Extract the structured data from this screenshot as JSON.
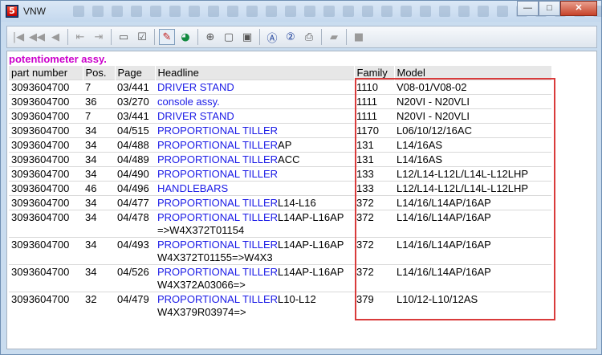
{
  "window": {
    "title": "VNW",
    "app_icon_letter": "5"
  },
  "toolbar": {
    "buttons": [
      {
        "name": "first-icon",
        "glyph": "|◀",
        "state": "disabled"
      },
      {
        "name": "rewind-icon",
        "glyph": "◀◀",
        "state": "disabled"
      },
      {
        "name": "prev-icon",
        "glyph": "◀",
        "state": "disabled"
      },
      {
        "name": "sep"
      },
      {
        "name": "page-back-icon",
        "glyph": "⇤",
        "state": "disabled"
      },
      {
        "name": "page-forward-icon",
        "glyph": "⇥",
        "state": "disabled"
      },
      {
        "name": "sep"
      },
      {
        "name": "cart-icon",
        "glyph": "▭",
        "state": "normal"
      },
      {
        "name": "checklist-icon",
        "glyph": "☑",
        "state": "normal"
      },
      {
        "name": "sep"
      },
      {
        "name": "pen-tool-icon",
        "glyph": "✎",
        "state": "active",
        "color": "red"
      },
      {
        "name": "globe-icon",
        "glyph": "◕",
        "state": "normal",
        "color": "green"
      },
      {
        "name": "sep"
      },
      {
        "name": "zoom-icon",
        "glyph": "⊕",
        "state": "normal"
      },
      {
        "name": "page-icon",
        "glyph": "▢",
        "state": "normal"
      },
      {
        "name": "page-copy-icon",
        "glyph": "▣",
        "state": "normal"
      },
      {
        "name": "sep"
      },
      {
        "name": "search-a-icon",
        "glyph": "Ⓐ",
        "state": "normal",
        "color": "blue"
      },
      {
        "name": "help-icon",
        "glyph": "②",
        "state": "normal",
        "color": "blue"
      },
      {
        "name": "print-icon",
        "glyph": "⎙",
        "state": "normal"
      },
      {
        "name": "sep"
      },
      {
        "name": "eraser-icon",
        "glyph": "▰",
        "state": "disabled"
      },
      {
        "name": "sep"
      },
      {
        "name": "stop-icon",
        "glyph": "■",
        "state": "disabled"
      }
    ]
  },
  "section_title": "potentiometer assy.",
  "columns": [
    "part number",
    "Pos.",
    "Page",
    "Headline",
    "Family",
    "Model"
  ],
  "rows": [
    {
      "part": "3093604700",
      "pos": "7",
      "page": "03/441",
      "headline": "DRIVER STAND",
      "headline_rest": "",
      "headline_line2": "",
      "family": "1110",
      "model": "V08-01/V08-02"
    },
    {
      "part": "3093604700",
      "pos": "36",
      "page": "03/270",
      "headline": "console assy.",
      "headline_rest": "",
      "headline_line2": "",
      "family": "1111",
      "model": "N20VI - N20VLI"
    },
    {
      "part": "3093604700",
      "pos": "7",
      "page": "03/441",
      "headline": "DRIVER STAND",
      "headline_rest": "",
      "headline_line2": "",
      "family": "1111",
      "model": "N20VI - N20VLI"
    },
    {
      "part": "3093604700",
      "pos": "34",
      "page": "04/515",
      "headline": "PROPORTIONAL TILLER",
      "headline_rest": "",
      "headline_line2": "",
      "family": "1170",
      "model": "L06/10/12/16AC"
    },
    {
      "part": "3093604700",
      "pos": "34",
      "page": "04/488",
      "headline": "PROPORTIONAL TILLER",
      "headline_rest": "AP",
      "headline_line2": "",
      "family": "131",
      "model": "L14/16AS"
    },
    {
      "part": "3093604700",
      "pos": "34",
      "page": "04/489",
      "headline": "PROPORTIONAL TILLER",
      "headline_rest": "ACC",
      "headline_line2": "",
      "family": "131",
      "model": "L14/16AS"
    },
    {
      "part": "3093604700",
      "pos": "34",
      "page": "04/490",
      "headline": "PROPORTIONAL TILLER",
      "headline_rest": "",
      "headline_line2": "",
      "family": "133",
      "model": "L12/L14-L12L/L14L-L12LHP"
    },
    {
      "part": "3093604700",
      "pos": "46",
      "page": "04/496",
      "headline": "HANDLEBARS",
      "headline_rest": "",
      "headline_line2": "",
      "family": "133",
      "model": "L12/L14-L12L/L14L-L12LHP"
    },
    {
      "part": "3093604700",
      "pos": "34",
      "page": "04/477",
      "headline": "PROPORTIONAL TILLER",
      "headline_rest": "L14-L16",
      "headline_line2": "",
      "family": "372",
      "model": "L14/16/L14AP/16AP"
    },
    {
      "part": "3093604700",
      "pos": "34",
      "page": "04/478",
      "headline": "PROPORTIONAL TILLER",
      "headline_rest": "L14AP-L16AP",
      "headline_line2": "=>W4X372T01154",
      "family": "372",
      "model": "L14/16/L14AP/16AP"
    },
    {
      "part": "3093604700",
      "pos": "34",
      "page": "04/493",
      "headline": "PROPORTIONAL TILLER",
      "headline_rest": "L14AP-L16AP",
      "headline_line2": "W4X372T01155=>W4X3",
      "family": "372",
      "model": "L14/16/L14AP/16AP"
    },
    {
      "part": "3093604700",
      "pos": "34",
      "page": "04/526",
      "headline": "PROPORTIONAL TILLER",
      "headline_rest": "L14AP-L16AP",
      "headline_line2": "W4X372A03066=>",
      "family": "372",
      "model": "L14/16/L14AP/16AP"
    },
    {
      "part": "3093604700",
      "pos": "32",
      "page": "04/479",
      "headline": "PROPORTIONAL TILLER",
      "headline_rest": "L10-L12",
      "headline_line2": "W4X379R03974=>",
      "family": "379",
      "model": "L10/12-L10/12AS"
    }
  ],
  "colors": {
    "section_title": "#cc00cc",
    "link": "#1a1ae6",
    "highlight_box": "#d93b3b"
  }
}
